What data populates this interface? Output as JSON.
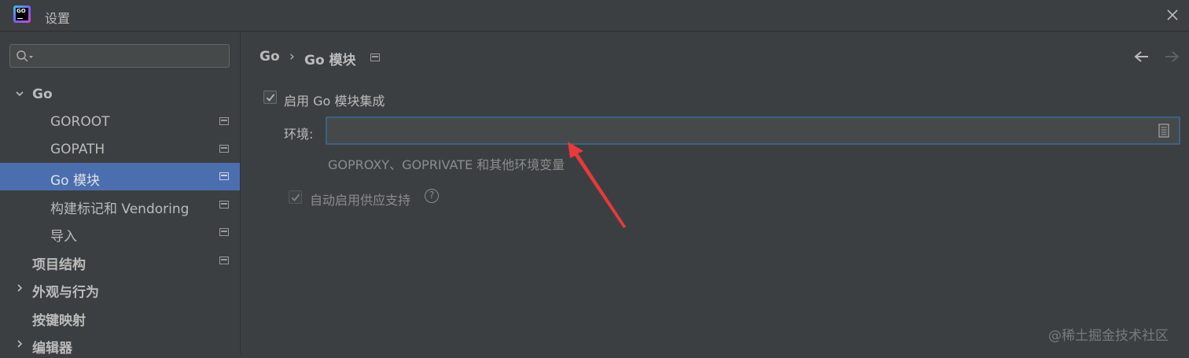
{
  "window": {
    "title": "设置",
    "logo_text": "GO"
  },
  "sidebar": {
    "search_placeholder": "",
    "items": [
      {
        "label": "Go"
      },
      {
        "label": "GOROOT"
      },
      {
        "label": "GOPATH"
      },
      {
        "label": "Go 模块"
      },
      {
        "label": "构建标记和 Vendoring"
      },
      {
        "label": "导入"
      },
      {
        "label": "项目结构"
      },
      {
        "label": "外观与行为"
      },
      {
        "label": "按键映射"
      },
      {
        "label": "编辑器"
      }
    ]
  },
  "content": {
    "breadcrumb": [
      "Go",
      "Go 模块"
    ],
    "breadcrumb_separator": "›",
    "enable_integration_label": "启用 Go 模块集成",
    "enable_integration_checked": true,
    "env_label": "环境:",
    "env_value": "",
    "env_hint": "GOPROXY、GOPRIVATE 和其他环境变量",
    "vendoring_label": "自动启用供应支持",
    "vendoring_checked": true,
    "help_glyph": "?"
  },
  "watermark": "@稀土掘金技术社区",
  "colors": {
    "background": "#3c3f41",
    "selection": "#4b6eaf",
    "focus_border": "#3d6185",
    "annotation_arrow": "#e8393c"
  },
  "icons": [
    "app-logo",
    "close-icon",
    "search-icon",
    "chevron-down-icon",
    "chevron-right-icon",
    "settings-page-icon",
    "back-arrow-icon",
    "forward-arrow-icon",
    "document-icon",
    "help-icon",
    "checkmark-icon"
  ]
}
